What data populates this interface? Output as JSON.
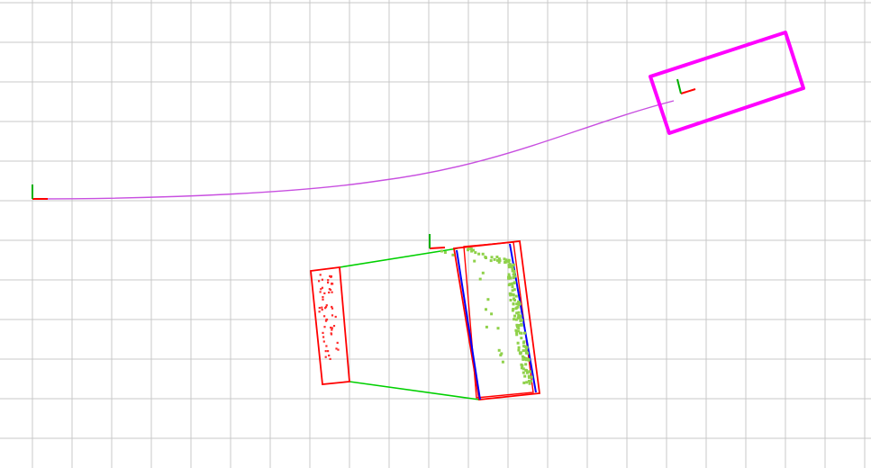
{
  "viewer": {
    "background": "#ffffff",
    "grid": {
      "shown": true,
      "color": "#c8c8c8"
    }
  },
  "colors": {
    "trajectory": "#c84fe0",
    "goal_box": "#ff00ff",
    "bounding_box": "#ff0000",
    "fitted_edge": "#0000ff",
    "link_line": "#00d000",
    "left_points": "#ff2a2a",
    "right_points": "#8fd14a",
    "axis_x": "#ff0000",
    "axis_y": "#00b000"
  },
  "icons": {
    "origin_frame": "coordinate-axes-icon",
    "goal_frame": "coordinate-axes-icon",
    "lidar_frame": "coordinate-axes-icon"
  }
}
